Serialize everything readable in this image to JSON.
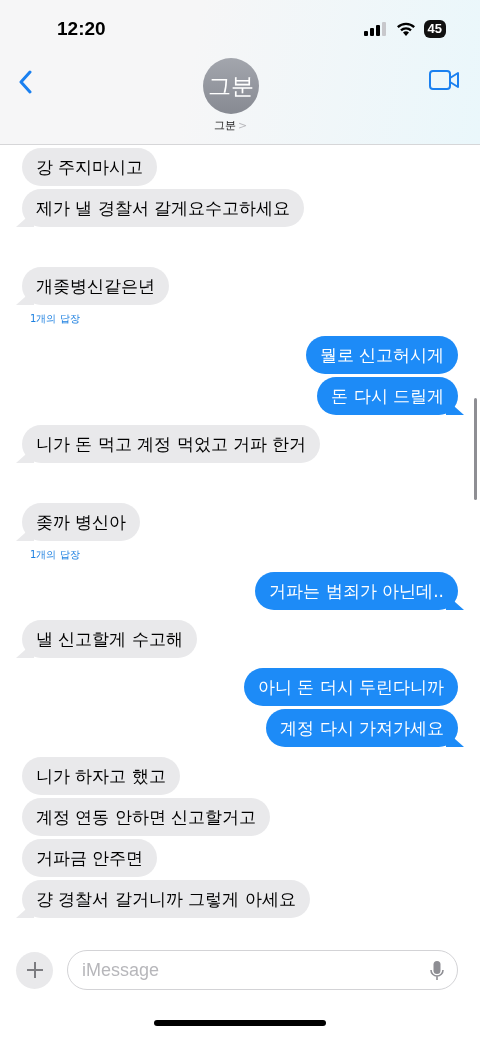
{
  "status_bar": {
    "time": "12:20",
    "battery": "45"
  },
  "header": {
    "avatar_initials": "그분",
    "contact_name": "그분",
    "chevron": ">"
  },
  "groups": [
    {
      "kind": "received",
      "messages": [
        "강 주지마시고",
        "제가 낼 경찰서 갈게요수고하세요"
      ]
    },
    {
      "kind": "received",
      "messages": [
        "개좆병신같은년"
      ],
      "replies": "1개의 답장"
    },
    {
      "kind": "sent",
      "messages": [
        "뭘로 신고허시게",
        "돈 다시 드릴게"
      ]
    },
    {
      "kind": "received",
      "messages": [
        "니가 돈 먹고 계정 먹었고 거파 한거"
      ]
    },
    {
      "kind": "received",
      "messages": [
        "좆까 병신아"
      ],
      "replies": "1개의 답장"
    },
    {
      "kind": "sent",
      "messages": [
        "거파는 범죄가 아닌데.."
      ]
    },
    {
      "kind": "received",
      "messages": [
        "낼 신고할게 수고해"
      ]
    },
    {
      "kind": "sent",
      "messages": [
        "아니 돈 더시 두린다니까",
        "계정 다시 가져가세요"
      ]
    },
    {
      "kind": "received",
      "messages": [
        "니가 하자고 했고",
        "계정 연동 안하면 신고할거고",
        "거파금 안주면",
        "걍 경찰서 갈거니까 그렇게 아세요"
      ]
    }
  ],
  "composer": {
    "placeholder": "iMessage"
  }
}
